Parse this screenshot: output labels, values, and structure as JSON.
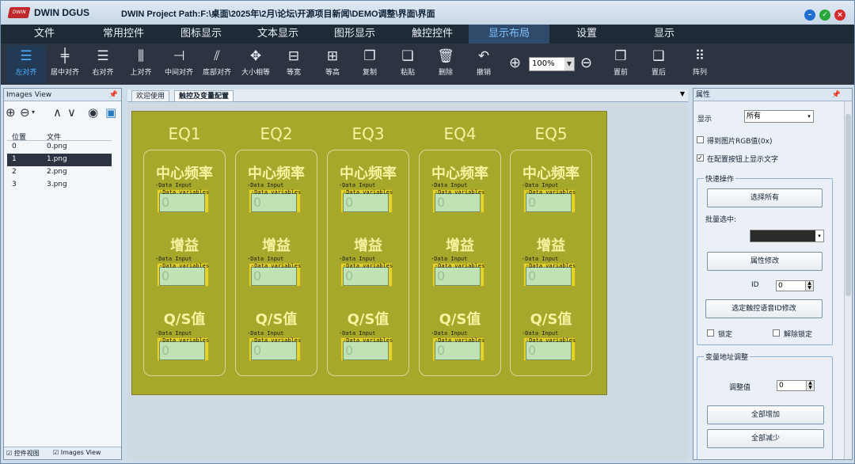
{
  "titlebar": {
    "logo_text": "DWIN",
    "app_name": "DWIN DGUS",
    "project_path": "DWIN Project Path:F:\\桌面\\2025年\\2月\\论坛\\开源项目新闻\\DEMO调整\\界面\\界面"
  },
  "window_buttons": {
    "minimize": "–",
    "maximize": "✓",
    "close": "×",
    "colors": {
      "minimize": "#1f6fd1",
      "maximize": "#2aa63a",
      "close": "#d52b2b"
    }
  },
  "menu": {
    "items": [
      "文件",
      "常用控件",
      "图标显示",
      "文本显示",
      "图形显示",
      "触控控件",
      "显示布局",
      "设置",
      "显示"
    ],
    "active": "显示布局"
  },
  "toolbar": {
    "items": [
      {
        "label": "左对齐",
        "icon": "align-left-icon",
        "glyph": "☰"
      },
      {
        "label": "居中对齐",
        "icon": "align-center-icon",
        "glyph": "╪"
      },
      {
        "label": "右对齐",
        "icon": "align-right-icon",
        "glyph": "☰"
      },
      {
        "label": "上对齐",
        "icon": "align-top-icon",
        "glyph": "⫼"
      },
      {
        "label": "中间对齐",
        "icon": "align-middle-icon",
        "glyph": "⊣"
      },
      {
        "label": "底部对齐",
        "icon": "align-bottom-icon",
        "glyph": "⫽"
      },
      {
        "label": "大小相等",
        "icon": "same-size-icon",
        "glyph": "✥"
      },
      {
        "label": "等宽",
        "icon": "same-width-icon",
        "glyph": "⊟"
      },
      {
        "label": "等高",
        "icon": "same-height-icon",
        "glyph": "⊞"
      },
      {
        "label": "复制",
        "icon": "copy-icon",
        "glyph": "❐"
      },
      {
        "label": "粘贴",
        "icon": "paste-icon",
        "glyph": "❏"
      },
      {
        "label": "删除",
        "icon": "delete-icon",
        "glyph": "🗑"
      },
      {
        "label": "撤销",
        "icon": "undo-icon",
        "glyph": "↶"
      },
      {
        "label": "置前",
        "icon": "bring-front-icon",
        "glyph": "❒"
      },
      {
        "label": "置后",
        "icon": "send-back-icon",
        "glyph": "❑"
      },
      {
        "label": "阵列",
        "icon": "array-icon",
        "glyph": "⠿"
      }
    ],
    "zoom_in_icon": "zoom-in-icon",
    "zoom_out_icon": "zoom-out-icon",
    "zoom_value": "100%"
  },
  "left_panel": {
    "title": "Images View",
    "columns": [
      "位置",
      "文件"
    ],
    "rows": [
      {
        "pos": "0",
        "file": "0.png"
      },
      {
        "pos": "1",
        "file": "1.png"
      },
      {
        "pos": "2",
        "file": "2.png"
      },
      {
        "pos": "3",
        "file": "3.png"
      }
    ],
    "selected_index": 1,
    "footer_tabs": [
      "控件视图",
      "Images View"
    ]
  },
  "center": {
    "tabs": [
      "欢迎使用",
      "触控及变量配置"
    ],
    "active_tab": "触控及变量配置",
    "design": {
      "columns": [
        "EQ1",
        "EQ2",
        "EQ3",
        "EQ4",
        "EQ5"
      ],
      "labels": [
        "中心频率",
        "增益",
        "Q/S值"
      ],
      "control_text1": "Data Input",
      "control_text2": "Data variables",
      "control_value": "0"
    }
  },
  "right_panel": {
    "title": "属性",
    "display_label": "显示",
    "display_value": "所有",
    "chk_rgb": "得到图片RGB值(0x)",
    "chk_show_text": "在配置按钮上显示文字",
    "quick_ops": {
      "title": "快速操作",
      "select_all": "选择所有",
      "batch_select": "批量选中:",
      "attr_modify": "属性修改",
      "id_label": "ID",
      "id_value": "0",
      "voice_id_modify": "选定触控语音ID修改",
      "lock": "锁定",
      "unlock": "解除锁定"
    },
    "var_addr": {
      "title": "变量地址调整",
      "adjust_label": "调整值",
      "adjust_value": "0",
      "increase_all": "全部增加",
      "decrease_all": "全部减少"
    }
  }
}
